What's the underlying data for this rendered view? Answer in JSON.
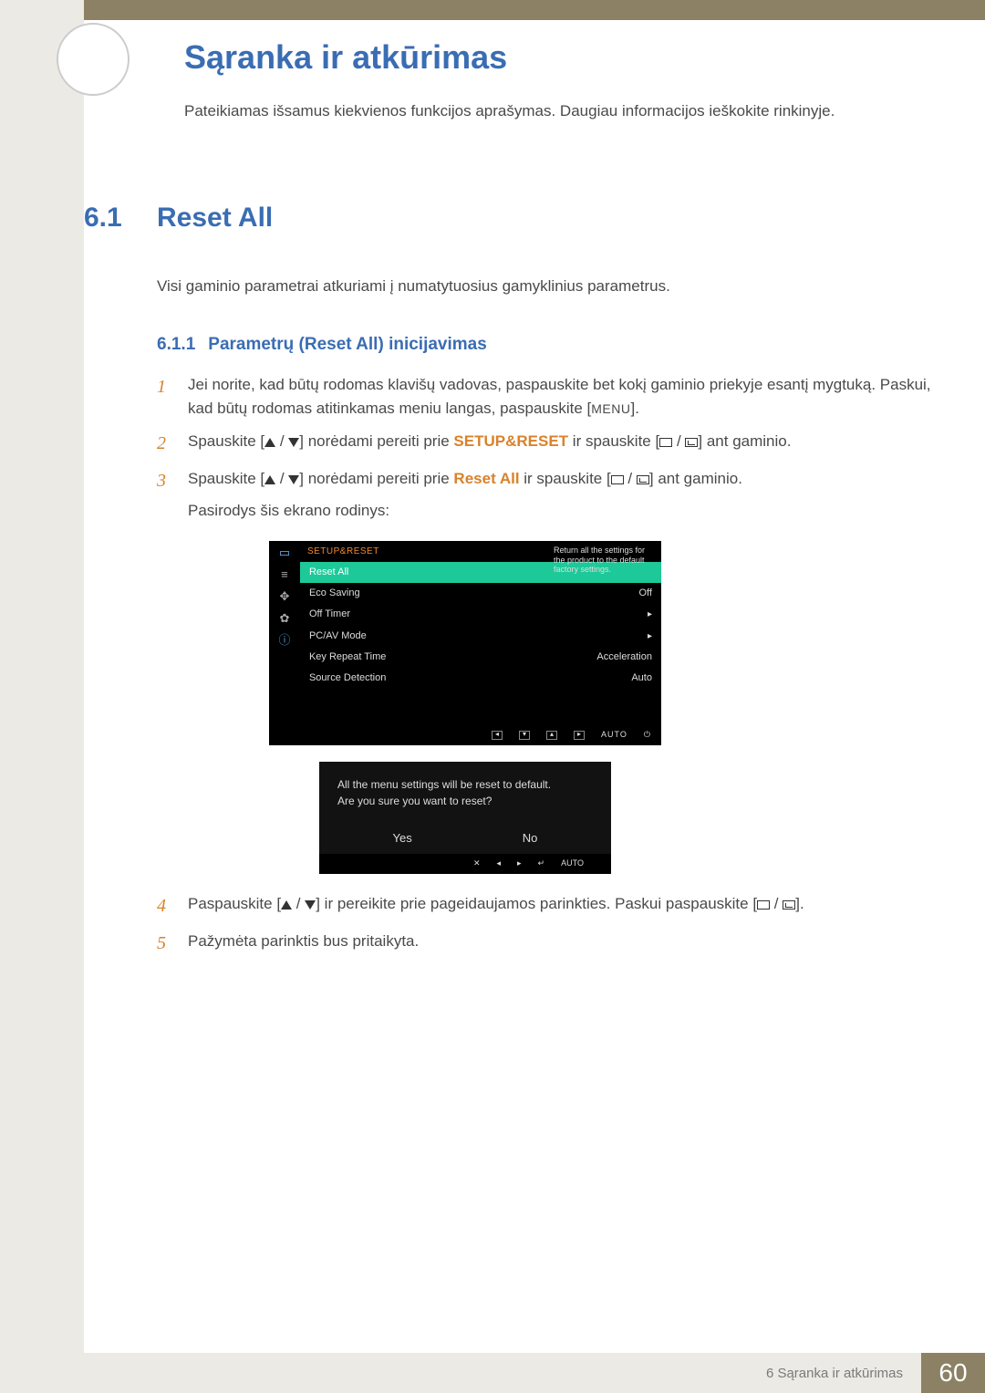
{
  "header": {
    "chapter_title": "Sąranka ir atkūrimas",
    "intro": "Pateikiamas išsamus kiekvienos funkcijos aprašymas. Daugiau informacijos ieškokite rinkinyje."
  },
  "section": {
    "num": "6.1",
    "title": "Reset All",
    "body": "Visi gaminio parametrai atkuriami į numatytuosius gamyklinius parametrus."
  },
  "subsection": {
    "num": "6.1.1",
    "title": "Parametrų (Reset All) inicijavimas"
  },
  "steps": {
    "s1": {
      "num": "1",
      "text_a": "Jei norite, kad būtų rodomas klavišų vadovas, paspauskite bet kokį gaminio priekyje esantį mygtuką. Paskui, kad būtų rodomas atitinkamas meniu langas, paspauskite [",
      "menu": "MENU",
      "text_b": "]."
    },
    "s2": {
      "num": "2",
      "text_a": "Spauskite [",
      "text_b": "] norėdami pereiti prie ",
      "kw": "SETUP&RESET",
      "text_c": " ir spauskite [",
      "text_d": "] ant gaminio."
    },
    "s3": {
      "num": "3",
      "text_a": "Spauskite [",
      "text_b": "] norėdami pereiti prie ",
      "kw": "Reset All",
      "text_c": " ir spauskite [",
      "text_d": "] ant gaminio.",
      "note": "Pasirodys šis ekrano rodinys:"
    },
    "s4": {
      "num": "4",
      "text_a": "Paspauskite [",
      "text_b": "] ir pereikite prie pageidaujamos parinkties. Paskui paspauskite [",
      "text_c": "]."
    },
    "s5": {
      "num": "5",
      "text": "Pažymėta parinktis bus pritaikyta."
    }
  },
  "osd": {
    "header": "SETUP&RESET",
    "tooltip": "Return all the settings for the product to the default factory settings.",
    "rows": [
      {
        "label": "Reset All",
        "value": "",
        "selected": true
      },
      {
        "label": "Eco Saving",
        "value": "Off"
      },
      {
        "label": "Off Timer",
        "value": "arrow"
      },
      {
        "label": "PC/AV Mode",
        "value": "arrow"
      },
      {
        "label": "Key Repeat Time",
        "value": "Acceleration"
      },
      {
        "label": "Source Detection",
        "value": "Auto"
      }
    ],
    "nav_auto": "AUTO"
  },
  "dialog": {
    "line1": "All the menu settings will be reset to default.",
    "line2": "Are you sure you want to reset?",
    "yes": "Yes",
    "no": "No",
    "nav_auto": "AUTO"
  },
  "footer": {
    "label": "6 Sąranka ir atkūrimas",
    "page": "60"
  }
}
